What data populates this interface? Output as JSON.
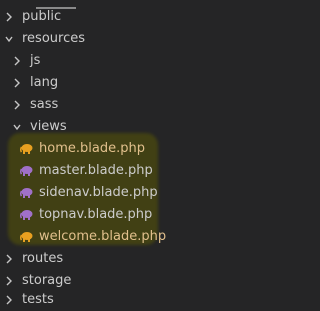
{
  "explorer": {
    "items": [
      {
        "label": "public",
        "type": "folder",
        "state": "collapsed"
      },
      {
        "label": "resources",
        "type": "folder",
        "state": "expanded"
      },
      {
        "label": "js",
        "type": "folder",
        "state": "collapsed"
      },
      {
        "label": "lang",
        "type": "folder",
        "state": "collapsed"
      },
      {
        "label": "sass",
        "type": "folder",
        "state": "collapsed"
      },
      {
        "label": "views",
        "type": "folder",
        "state": "expanded"
      },
      {
        "label": "home.blade.php",
        "type": "file",
        "icon": "php-elephant-icon",
        "icon_color": "#e8a020"
      },
      {
        "label": "master.blade.php",
        "type": "file",
        "icon": "php-elephant-icon",
        "icon_color": "#a070c8"
      },
      {
        "label": "sidenav.blade.php",
        "type": "file",
        "icon": "php-elephant-icon",
        "icon_color": "#a070c8"
      },
      {
        "label": "topnav.blade.php",
        "type": "file",
        "icon": "php-elephant-icon",
        "icon_color": "#a070c8"
      },
      {
        "label": "welcome.blade.php",
        "type": "file",
        "icon": "php-elephant-icon",
        "icon_color": "#e8a020"
      },
      {
        "label": "routes",
        "type": "folder",
        "state": "collapsed"
      },
      {
        "label": "storage",
        "type": "folder",
        "state": "collapsed"
      },
      {
        "label": "tests",
        "type": "folder",
        "state": "collapsed"
      }
    ]
  },
  "colors": {
    "background": "#252526",
    "text": "#cccccc",
    "modified_text": "#e2c08d",
    "highlight": "#4b4a0e"
  }
}
